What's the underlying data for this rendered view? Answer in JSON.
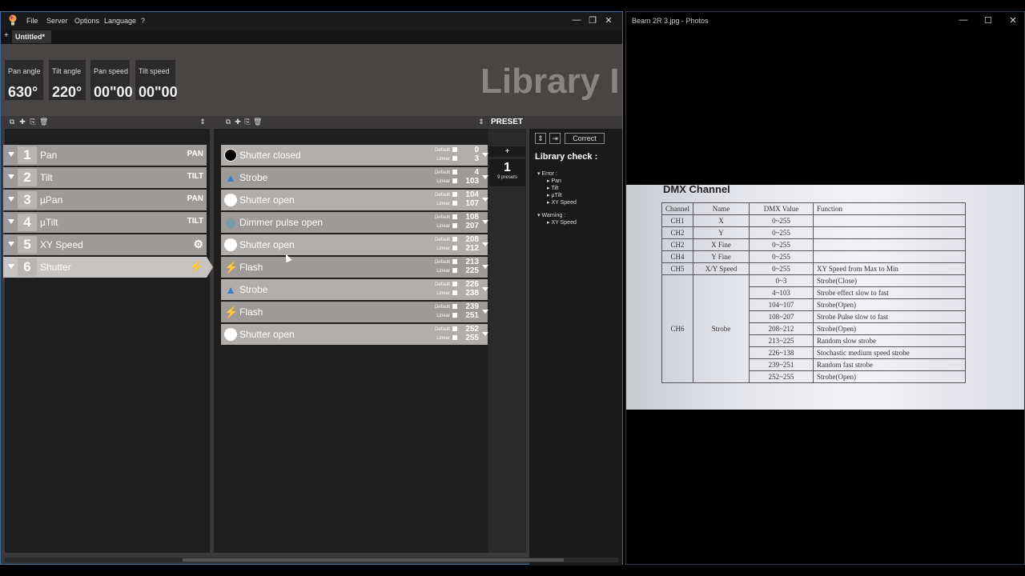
{
  "app": {
    "menu": [
      "File",
      "Server",
      "Options",
      "Language",
      "?"
    ],
    "tab": "Untitled*",
    "window_buttons": [
      "—",
      "❐",
      "✕"
    ]
  },
  "header": {
    "metrics": [
      {
        "label": "Pan angle",
        "value": "630°"
      },
      {
        "label": "Tilt angle",
        "value": "220°"
      },
      {
        "label": "Pan speed",
        "value": "00\"00"
      },
      {
        "label": "Tilt speed",
        "value": "00\"00"
      }
    ],
    "title": "Library I"
  },
  "channels": [
    {
      "num": "1",
      "name": "Pan",
      "icon": "PAN"
    },
    {
      "num": "2",
      "name": "Tilt",
      "icon": "TILT"
    },
    {
      "num": "3",
      "name": "µPan",
      "icon": "PAN"
    },
    {
      "num": "4",
      "name": "µTilt",
      "icon": "TILT"
    },
    {
      "num": "5",
      "name": "XY Speed",
      "icon": "⚙"
    },
    {
      "num": "6",
      "name": "Shutter",
      "icon": "⚡"
    }
  ],
  "presets": [
    {
      "name": "Shutter closed",
      "icon": "●",
      "from": "0",
      "to": "3"
    },
    {
      "name": "Strobe",
      "icon": "▲",
      "from": "4",
      "to": "103"
    },
    {
      "name": "Shutter open",
      "icon": "○",
      "from": "104",
      "to": "107"
    },
    {
      "name": "Dimmer pulse open",
      "icon": "◎",
      "from": "108",
      "to": "207"
    },
    {
      "name": "Shutter open",
      "icon": "○",
      "from": "208",
      "to": "212"
    },
    {
      "name": "Flash",
      "icon": "⚡",
      "from": "213",
      "to": "225"
    },
    {
      "name": "Strobe",
      "icon": "▲",
      "from": "226",
      "to": "238"
    },
    {
      "name": "Flash",
      "icon": "⚡",
      "from": "239",
      "to": "251"
    },
    {
      "name": "Shutter open",
      "icon": "○",
      "from": "252",
      "to": "255"
    }
  ],
  "flag_labels": {
    "default": "Default",
    "linear": "Linear"
  },
  "preset_panel": {
    "label": "PRESET",
    "add": "+",
    "count": "1",
    "sub": "9 presets"
  },
  "library_check": {
    "correct": "Correct",
    "title": "Library check :",
    "error_label": "Error :",
    "errors": [
      "Pan",
      "Tilt",
      "µTilt",
      "XY Speed"
    ],
    "warning_label": "Warning :",
    "warnings": [
      "XY Speed"
    ]
  },
  "photos": {
    "title": "Beam 2R 3.jpg - Photos",
    "doc_title": "DMX Channel",
    "table_headers": [
      "Channel",
      "Name",
      "DMX Value",
      "Function"
    ],
    "table_rows": [
      [
        "CH1",
        "X",
        "0~255",
        ""
      ],
      [
        "CH2",
        "Y",
        "0~255",
        ""
      ],
      [
        "CH2",
        "X Fine",
        "0~255",
        ""
      ],
      [
        "CH4",
        "Y Fine",
        "0~255",
        ""
      ],
      [
        "CH5",
        "X/Y Speed",
        "0~255",
        "XY Speed from Max to Min"
      ]
    ],
    "ch6": {
      "channel": "CH6",
      "name": "Strobe"
    },
    "ch6_rows": [
      [
        "0~3",
        "Strobe(Close)"
      ],
      [
        "4~103",
        "Strobe effect slow to fast"
      ],
      [
        "104~107",
        "Strobe(Open)"
      ],
      [
        "108~207",
        "Strobe Pulse slow to fast"
      ],
      [
        "208~212",
        "Strobe(Open)"
      ],
      [
        "213~225",
        "Random slow strobe"
      ],
      [
        "226~138",
        "Stochastic medium speed strobe"
      ],
      [
        "239~251",
        "Random fast strobe"
      ],
      [
        "252~255",
        "Strobe(Open)"
      ]
    ]
  },
  "colors": {
    "accent": "#3b6aa0",
    "row": "#9e9a98",
    "row_sel": "#c7c3c1"
  }
}
